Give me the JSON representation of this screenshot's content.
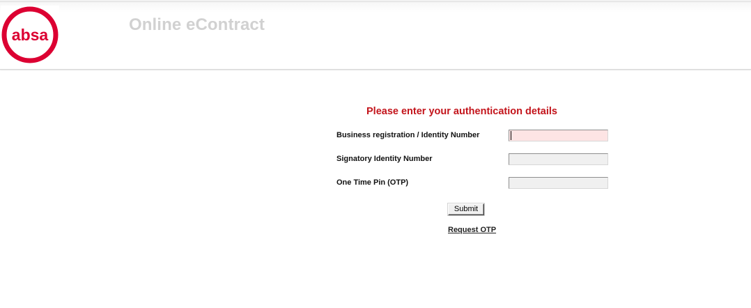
{
  "header": {
    "logo_text": "absa",
    "app_title": "Online eContract"
  },
  "form": {
    "heading": "Please enter your authentication details",
    "fields": [
      {
        "label": "Business registration / Identity Number",
        "value": "",
        "focused": true
      },
      {
        "label": "Signatory Identity Number",
        "value": ""
      },
      {
        "label": "One Time Pin (OTP)",
        "value": ""
      }
    ],
    "submit_label": "Submit",
    "request_otp_label": "Request OTP"
  },
  "colors": {
    "brand_red": "#dc0032",
    "heading_red": "#c3141b",
    "title_grey": "#d1d1d1",
    "focused_field": "#fde4e4"
  }
}
